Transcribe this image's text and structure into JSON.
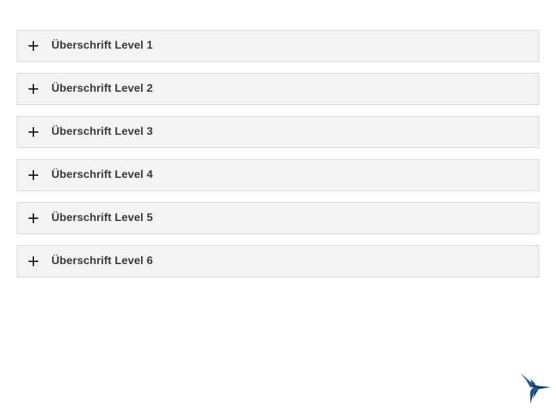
{
  "accordion": {
    "items": [
      {
        "label": "Überschrift Level 1",
        "icon": "plus-icon"
      },
      {
        "label": "Überschrift Level 2",
        "icon": "plus-icon"
      },
      {
        "label": "Überschrift Level 3",
        "icon": "plus-icon"
      },
      {
        "label": "Überschrift Level 4",
        "icon": "plus-icon"
      },
      {
        "label": "Überschrift Level 5",
        "icon": "plus-icon"
      },
      {
        "label": "Überschrift Level 6",
        "icon": "plus-icon"
      }
    ]
  },
  "logo": {
    "icon": "hummingbird-icon",
    "color": "#1a4f8a"
  },
  "colors": {
    "item_background": "#f3f3f3",
    "item_border": "#d7d7d7",
    "heading_text": "#3a3a3a",
    "icon": "#1b1b1b"
  }
}
